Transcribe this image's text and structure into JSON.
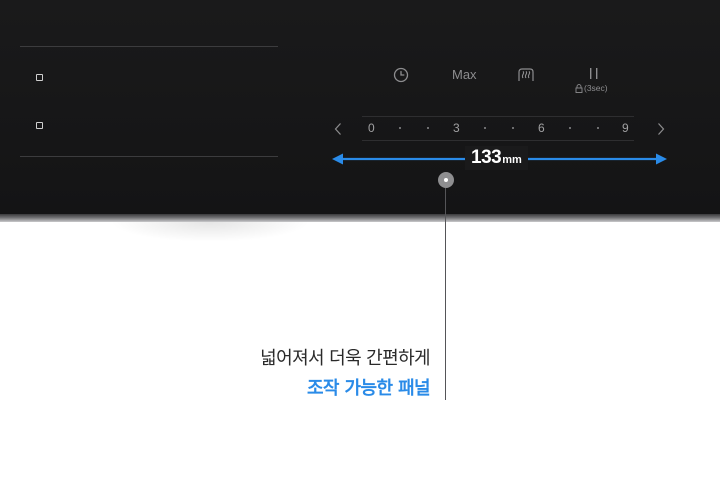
{
  "controls": {
    "timer_icon": "clock-icon",
    "max_label": "Max",
    "keep_warm_icon": "keep-warm-icon",
    "pause_icon": "pause-icon",
    "lock_label": "(3sec)",
    "lock_icon": "lock-icon"
  },
  "slider": {
    "ticks": [
      "0",
      "3",
      "6",
      "9"
    ],
    "prev_icon": "chevron-left-icon",
    "next_icon": "chevron-right-icon"
  },
  "dimension": {
    "value": "133",
    "unit": "mm",
    "color": "#2a8be8"
  },
  "caption": {
    "line1": "넓어져서 더욱 간편하게",
    "line2": "조작 가능한 패널",
    "highlight_color": "#2a8be8"
  },
  "colors": {
    "panel": "#161617",
    "text_dim": "#8d8d8f"
  }
}
